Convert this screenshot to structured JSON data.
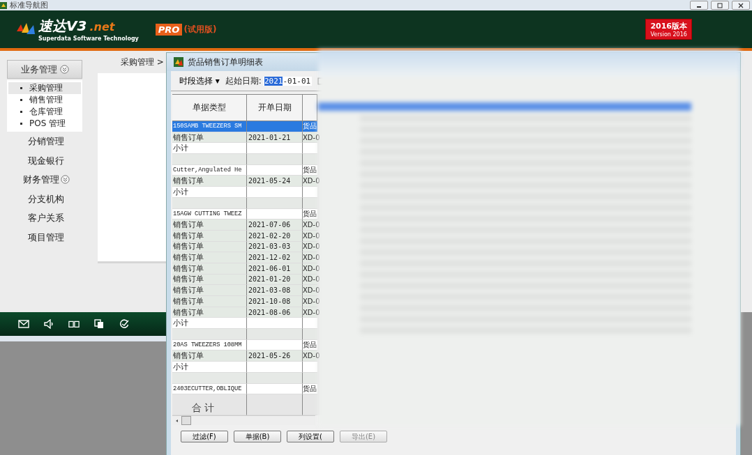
{
  "window": {
    "title": "标准导航图"
  },
  "header": {
    "logo": "速达V3",
    "logo_suffix": ".net",
    "tagline": "Superdata Software Technology",
    "edition": "PRO",
    "trial": "(试用版)",
    "version_badge": "2016版本",
    "version_sub": "Version 2016"
  },
  "sidebar": {
    "items": [
      {
        "label": "业务管理",
        "kind": "group",
        "expanded": true,
        "children": [
          {
            "label": "采购管理",
            "selected": true
          },
          {
            "label": "销售管理",
            "selected": false
          },
          {
            "label": "仓库管理",
            "selected": false
          },
          {
            "label": "POS 管理",
            "selected": false
          }
        ]
      },
      {
        "label": "分销管理",
        "kind": "item"
      },
      {
        "label": "现金银行",
        "kind": "item"
      },
      {
        "label": "财务管理",
        "kind": "group",
        "expanded": false
      },
      {
        "label": "分支机构",
        "kind": "item"
      },
      {
        "label": "客户关系",
        "kind": "item"
      },
      {
        "label": "项目管理",
        "kind": "item"
      }
    ]
  },
  "breadcrumb": "采购管理 >",
  "dialog": {
    "title": "货品销售订单明细表",
    "period_select": "时段选择",
    "period_caret": "▾",
    "start_label": "起始日期:",
    "date_selected": "2021",
    "date_rest": "-01-01",
    "table": {
      "columns": [
        "单据类型",
        "开单日期"
      ],
      "rows": [
        {
          "kind": "group",
          "cells": [
            "150SAMB TWEEZERS SM",
            "",
            "货品"
          ],
          "selected": true
        },
        {
          "kind": "order",
          "cells": [
            "销售订单",
            "2021-01-21",
            "XD-0"
          ],
          "selected": false
        },
        {
          "kind": "subtotal",
          "cells": [
            "小计"
          ],
          "selected": false
        },
        {
          "kind": "blank",
          "cells": [],
          "selected": false
        },
        {
          "kind": "group",
          "cells": [
            "Cutter,Angulated He",
            "",
            "货品"
          ],
          "selected": false
        },
        {
          "kind": "order",
          "cells": [
            "销售订单",
            "2021-05-24",
            "XD-0"
          ],
          "selected": false
        },
        {
          "kind": "subtotal",
          "cells": [
            "小计"
          ],
          "selected": false
        },
        {
          "kind": "blank",
          "cells": [],
          "selected": false
        },
        {
          "kind": "group",
          "cells": [
            "15AGW CUTTING TWEEZ",
            "",
            "货品"
          ],
          "selected": false
        },
        {
          "kind": "order",
          "cells": [
            "销售订单",
            "2021-07-06",
            "XD-0"
          ],
          "selected": false
        },
        {
          "kind": "order",
          "cells": [
            "销售订单",
            "2021-02-20",
            "XD-0"
          ],
          "selected": false
        },
        {
          "kind": "order",
          "cells": [
            "销售订单",
            "2021-03-03",
            "XD-0"
          ],
          "selected": false
        },
        {
          "kind": "order",
          "cells": [
            "销售订单",
            "2021-12-02",
            "XD-0"
          ],
          "selected": false
        },
        {
          "kind": "order",
          "cells": [
            "销售订单",
            "2021-06-01",
            "XD-0"
          ],
          "selected": false
        },
        {
          "kind": "order",
          "cells": [
            "销售订单",
            "2021-01-20",
            "XD-0"
          ],
          "selected": false
        },
        {
          "kind": "order",
          "cells": [
            "销售订单",
            "2021-03-08",
            "XD-0"
          ],
          "selected": false
        },
        {
          "kind": "order",
          "cells": [
            "销售订单",
            "2021-10-08",
            "XD-0"
          ],
          "selected": false
        },
        {
          "kind": "order",
          "cells": [
            "销售订单",
            "2021-08-06",
            "XD-0"
          ],
          "selected": false
        },
        {
          "kind": "subtotal",
          "cells": [
            "小计"
          ],
          "selected": false
        },
        {
          "kind": "blank",
          "cells": [],
          "selected": false
        },
        {
          "kind": "group",
          "cells": [
            "20AS TWEEZERS 108MM",
            "",
            "货品"
          ],
          "selected": false
        },
        {
          "kind": "order",
          "cells": [
            "销售订单",
            "2021-05-26",
            "XD-0"
          ],
          "selected": false
        },
        {
          "kind": "subtotal",
          "cells": [
            "小计"
          ],
          "selected": false
        },
        {
          "kind": "blank",
          "cells": [],
          "selected": false
        },
        {
          "kind": "group",
          "cells": [
            "2403ECUTTER,OBLIQUE",
            "",
            "货品"
          ],
          "selected": false
        },
        {
          "kind": "total",
          "cells": [
            "合 计"
          ],
          "selected": false
        }
      ]
    },
    "buttons": [
      "过滤(F)",
      "单据(B)",
      "列设置(",
      "导出(E)"
    ]
  }
}
